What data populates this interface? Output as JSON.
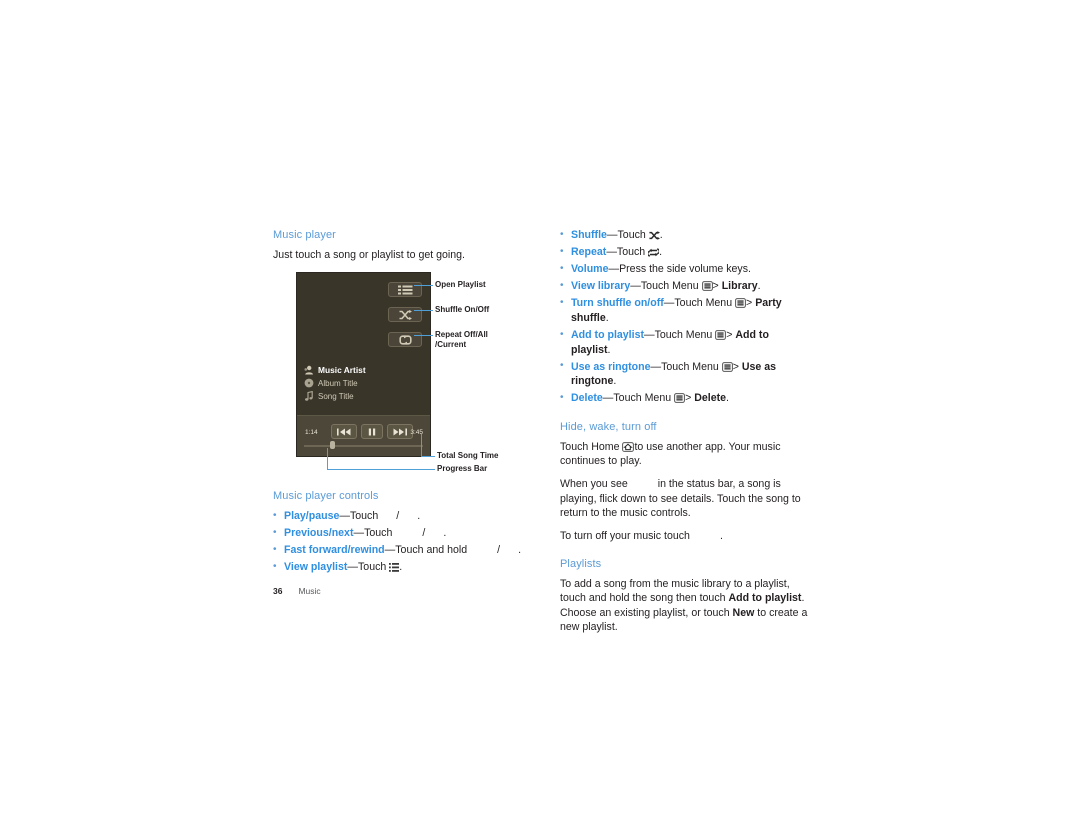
{
  "page": {
    "number": "36",
    "chapter": "Music"
  },
  "colors": {
    "heading_blue": "#5b9bd5",
    "term_blue": "#2f8fe0",
    "leader_blue": "#4f9fd8",
    "phone_body": "#35312a",
    "phone_screen": "#393529",
    "transport_bar": "#4c4739",
    "body_text": "#231f20"
  },
  "left_column": {
    "section1": {
      "heading": "Music player",
      "intro": "Just touch a song or playlist to get going."
    },
    "figure": {
      "callouts": [
        {
          "label": "Open Playlist",
          "icon": "playlist-icon"
        },
        {
          "label": "Shuffle On/Off",
          "icon": "shuffle-icon"
        },
        {
          "label": "Repeat Off/All\n/Current",
          "line1": "Repeat Off/All",
          "line2": "/Current",
          "icon": "repeat-icon"
        },
        {
          "label": "Total Song Time"
        },
        {
          "label": "Progress Bar"
        }
      ],
      "player": {
        "artist": "Music Artist",
        "album": "Album Title",
        "song": "Song Title",
        "current_time": "1:14",
        "total_time": "3:45"
      }
    },
    "section2": {
      "heading": "Music player controls",
      "bullets": [
        {
          "term": "Play/pause",
          "text_before": "—Touch",
          "sep": "/",
          "text_after": "."
        },
        {
          "term": "Previous/next",
          "text_before": "—Touch",
          "sep": "/",
          "text_after": "."
        },
        {
          "term": "Fast forward/rewind",
          "text_before": "—Touch and hold",
          "sep": "/",
          "text_after": "."
        },
        {
          "term": "View playlist",
          "text_before": "—Touch",
          "icon": "playlist-icon",
          "text_after": "."
        }
      ]
    }
  },
  "right_column": {
    "bullets_top": [
      {
        "term": "Shuffle",
        "dash": "—Touch",
        "icon": "shuffle-icon",
        "tail": "."
      },
      {
        "term": "Repeat",
        "dash": "—Touch",
        "icon": "repeat-icon",
        "tail": "."
      },
      {
        "term": "Volume",
        "dash": "—Press the side volume keys.",
        "icon": null,
        "tail": ""
      },
      {
        "term": "View library",
        "dash": "—Touch Menu",
        "icon": "menu-icon",
        "arrow": ">",
        "bold_target": "Library",
        "tail": "."
      },
      {
        "term": "Turn shuffle on/off",
        "dash": "—Touch Menu",
        "icon": "menu-icon",
        "arrow": ">",
        "bold_target": "Party shuffle",
        "tail": "."
      },
      {
        "term": "Add to playlist",
        "dash": "—Touch Menu",
        "icon": "menu-icon",
        "arrow": ">",
        "bold_target": "Add to playlist",
        "tail": "."
      },
      {
        "term": "Use as ringtone",
        "dash": "—Touch Menu",
        "icon": "menu-icon",
        "arrow": ">",
        "bold_target": "Use as ringtone",
        "tail": "."
      },
      {
        "term": "Delete",
        "dash": "—Touch Menu",
        "icon": "menu-icon",
        "arrow": ">",
        "bold_target": "Delete",
        "tail": "."
      }
    ],
    "section_hide": {
      "heading": "Hide, wake, turn off",
      "para1_before": "Touch Home",
      "para1_icon": "home-icon",
      "para1_after": "to use another app. Your music continues to play.",
      "para2_before": "When you see",
      "para2_after": "in the status bar, a song is playing, flick down to see details. Touch the song to return to the music controls.",
      "para3_before": "To turn off your music touch",
      "para3_after": "."
    },
    "section_playlists": {
      "heading": "Playlists",
      "para_part1": "To add a song from the music library to a playlist, touch and hold the song then touch ",
      "para_bold1": "Add to playlist",
      "para_part2": ". Choose an existing playlist, or touch ",
      "para_bold2": "New",
      "para_part3": " to create a new playlist."
    }
  }
}
